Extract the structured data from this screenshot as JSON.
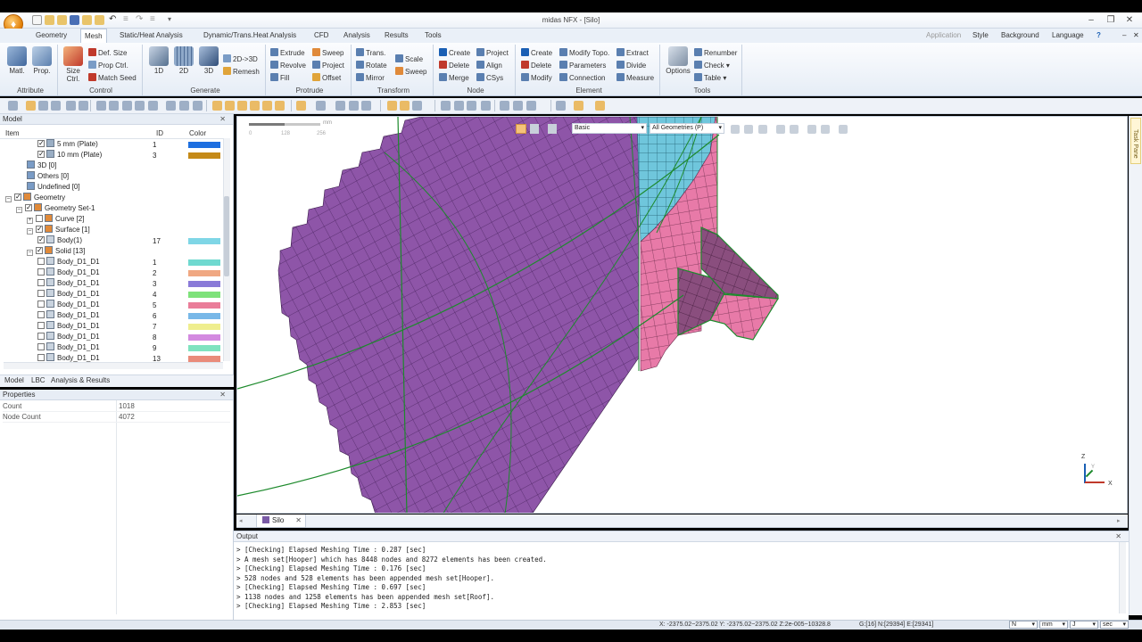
{
  "window": {
    "title": "midas NFX - [Silo]"
  },
  "ribbon_tabs": [
    "Geometry",
    "Mesh",
    "Static/Heat Analysis",
    "Dynamic/Trans.Heat Analysis",
    "CFD",
    "Analysis",
    "Results",
    "Tools"
  ],
  "ribbon_right": {
    "application": "Application",
    "style": "Style",
    "background": "Background",
    "language": "Language"
  },
  "ribbon": {
    "attribute": {
      "label": "Attribute",
      "matl": "Matl.",
      "prop": "Prop."
    },
    "control": {
      "label": "Control",
      "size_ctrl": "Size Ctrl.",
      "def_size": "Def. Size",
      "prop_ctrl": "Prop Ctrl.",
      "match_seed": "Match Seed"
    },
    "generate": {
      "label": "Generate",
      "b1d": "1D",
      "b2d": "2D",
      "b3d": "3D",
      "to3d": "2D->3D",
      "remesh": "Remesh"
    },
    "protrude": {
      "label": "Protrude",
      "extrude": "Extrude",
      "revolve": "Revolve",
      "fill": "Fill",
      "sweep": "Sweep",
      "project": "Project",
      "offset": "Offset"
    },
    "transform": {
      "label": "Transform",
      "trans": "Trans.",
      "rotate": "Rotate",
      "mirror": "Mirror",
      "scale": "Scale",
      "sweep": "Sweep"
    },
    "node": {
      "label": "Node",
      "create": "Create",
      "delete": "Delete",
      "merge": "Merge",
      "project": "Project",
      "align": "Align",
      "csys": "CSys"
    },
    "element": {
      "label": "Element",
      "create": "Create",
      "delete": "Delete",
      "modify": "Modify",
      "modify_topo": "Modify Topo.",
      "parameters": "Parameters",
      "connection": "Connection",
      "extract": "Extract",
      "divide": "Divide",
      "measure": "Measure"
    },
    "tools": {
      "label": "Tools",
      "options": "Options",
      "renumber": "Renumber",
      "check": "Check",
      "table": "Table"
    }
  },
  "model_panel": {
    "title": "Model",
    "col_item": "Item",
    "col_id": "ID",
    "col_color": "Color",
    "rows": [
      {
        "label": "5 mm (Plate)",
        "id": "1",
        "color": "#1e6fe0",
        "indent": 3,
        "check": true,
        "icon": "mesh"
      },
      {
        "label": "10 mm (Plate)",
        "id": "3",
        "color": "#c58a18",
        "indent": 3,
        "check": true,
        "icon": "mesh"
      },
      {
        "label": "3D [0]",
        "id": "",
        "color": "",
        "indent": 2,
        "check": false,
        "icon": "3d"
      },
      {
        "label": "Others [0]",
        "id": "",
        "color": "",
        "indent": 2,
        "check": false,
        "icon": "h"
      },
      {
        "label": "Undefined [0]",
        "id": "",
        "color": "",
        "indent": 2,
        "check": false,
        "icon": "h"
      },
      {
        "label": "Geometry",
        "id": "",
        "color": "",
        "indent": 0,
        "check": true,
        "icon": "geo",
        "exp": "-"
      },
      {
        "label": "Geometry Set-1",
        "id": "",
        "color": "",
        "indent": 1,
        "check": true,
        "icon": "geo",
        "exp": "-"
      },
      {
        "label": "Curve [2]",
        "id": "",
        "color": "",
        "indent": 2,
        "check": false,
        "icon": "geo",
        "exp": "+"
      },
      {
        "label": "Surface [1]",
        "id": "",
        "color": "",
        "indent": 2,
        "check": true,
        "icon": "geo",
        "exp": "-"
      },
      {
        "label": "Body(1)",
        "id": "17",
        "color": "#7fd6e6",
        "indent": 3,
        "check": true,
        "icon": "body"
      },
      {
        "label": "Solid [13]",
        "id": "",
        "color": "",
        "indent": 2,
        "check": true,
        "icon": "geo",
        "exp": "-"
      },
      {
        "label": "Body_D1_D1",
        "id": "1",
        "color": "#6fd9d0",
        "indent": 3,
        "check": false,
        "icon": "body"
      },
      {
        "label": "Body_D1_D1",
        "id": "2",
        "color": "#f0a882",
        "indent": 3,
        "check": false,
        "icon": "body"
      },
      {
        "label": "Body_D1_D1",
        "id": "3",
        "color": "#8a7ad8",
        "indent": 3,
        "check": false,
        "icon": "body"
      },
      {
        "label": "Body_D1_D1",
        "id": "4",
        "color": "#7ee27a",
        "indent": 3,
        "check": false,
        "icon": "body"
      },
      {
        "label": "Body_D1_D1",
        "id": "5",
        "color": "#ea7d99",
        "indent": 3,
        "check": false,
        "icon": "body"
      },
      {
        "label": "Body_D1_D1",
        "id": "6",
        "color": "#78b8e8",
        "indent": 3,
        "check": false,
        "icon": "body"
      },
      {
        "label": "Body_D1_D1",
        "id": "7",
        "color": "#efee8e",
        "indent": 3,
        "check": false,
        "icon": "body"
      },
      {
        "label": "Body_D1_D1",
        "id": "8",
        "color": "#d38ae0",
        "indent": 3,
        "check": false,
        "icon": "body"
      },
      {
        "label": "Body_D1_D1",
        "id": "9",
        "color": "#7fe3bf",
        "indent": 3,
        "check": false,
        "icon": "body"
      },
      {
        "label": "Body_D1_D1",
        "id": "13",
        "color": "#e98b7a",
        "indent": 3,
        "check": false,
        "icon": "body"
      }
    ],
    "tabs": [
      "Model",
      "LBC",
      "Analysis & Results"
    ]
  },
  "properties": {
    "title": "Properties",
    "rows": [
      {
        "name": "Count",
        "value": "1018"
      },
      {
        "name": "Node Count",
        "value": "4072"
      }
    ]
  },
  "viewport": {
    "render_mode": "Basic",
    "filter": "All Geometries (P)",
    "scale_unit": "mm",
    "scale_ticks": [
      "0",
      "128",
      "256"
    ],
    "axes": {
      "x": "X",
      "y": "Y",
      "z": "Z"
    }
  },
  "doc_tab": "Silo",
  "task_pane": "Task Pane",
  "output": {
    "title": "Output",
    "lines": [
      "> [Checking] Elapsed Meshing Time : 0.287 [sec]",
      "> A mesh set[Hooper] which has 8448 nodes and 8272 elements has been created.",
      "> [Checking] Elapsed Meshing Time : 0.176 [sec]",
      "> 528 nodes and 528 elements has been appended mesh set[Hooper].",
      "> [Checking] Elapsed Meshing Time : 0.697 [sec]",
      "> 1138 nodes and 1258 elements has been appended mesh set[Roof].",
      "> [Checking] Elapsed Meshing Time : 2.853 [sec]"
    ]
  },
  "status": {
    "coords": "X: -2375.02~2375.02 Y: -2375.02~2375.02 Z:2e-005~10328.8",
    "counts": "G:[16] N:[29394] E:[29341]",
    "unit_force": "N",
    "unit_length": "mm",
    "unit_energy": "J",
    "unit_time": "sec"
  },
  "colors": {
    "purple_mesh": "#8e55a8",
    "purple_dark": "#6e3f8a",
    "pink_mesh": "#e87aa8",
    "cyan_mesh": "#6fc6dc",
    "green_edge": "#1d8a2c"
  }
}
